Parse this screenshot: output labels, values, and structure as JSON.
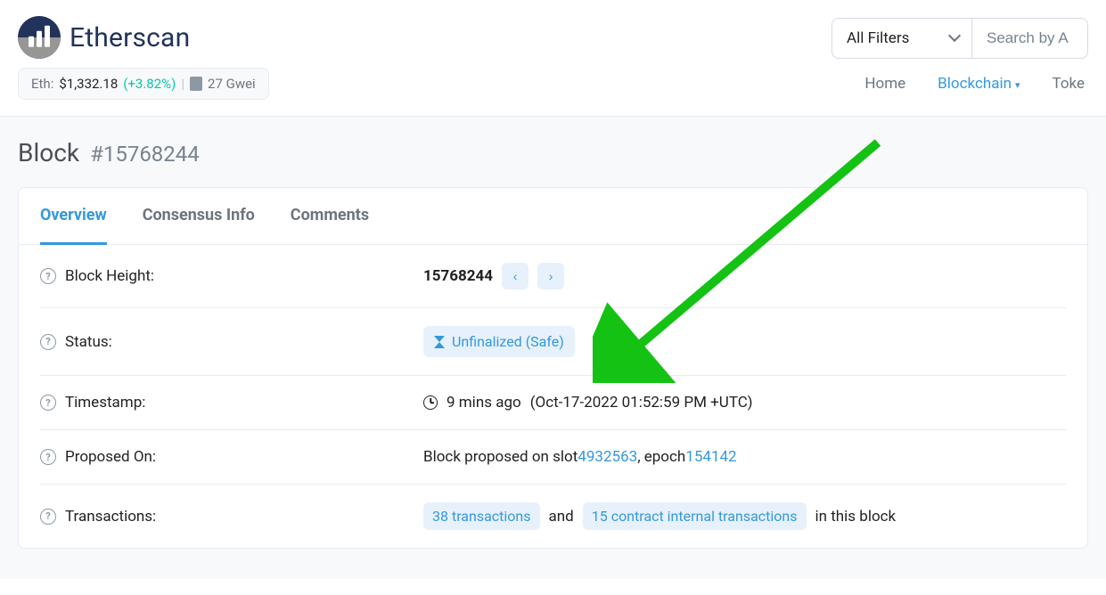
{
  "brand": "Etherscan",
  "filter": {
    "selected": "All Filters"
  },
  "search": {
    "placeholder": "Search by A"
  },
  "price": {
    "prefix": "Eth: ",
    "value": "$1,332.18",
    "pct": "(+3.82%)",
    "sep": "|",
    "gas": "27 Gwei"
  },
  "nav": {
    "home": "Home",
    "blockchain": "Blockchain",
    "tokens": "Toke"
  },
  "title": {
    "label": "Block",
    "number": "#15768244"
  },
  "tabs": {
    "overview": "Overview",
    "consensus": "Consensus Info",
    "comments": "Comments"
  },
  "rows": {
    "height": {
      "label": "Block Height:",
      "value": "15768244"
    },
    "status": {
      "label": "Status:",
      "badge": "Unfinalized (Safe)"
    },
    "timestamp": {
      "label": "Timestamp:",
      "ago": "9 mins ago",
      "full": "(Oct-17-2022 01:52:59 PM +UTC)"
    },
    "proposed": {
      "label": "Proposed On:",
      "prefix": "Block proposed on slot ",
      "slot": "4932563",
      "mid": ", epoch ",
      "epoch": "154142"
    },
    "txs": {
      "label": "Transactions:",
      "tx_chip": "38 transactions",
      "and": "and",
      "internal_chip": "15 contract internal transactions",
      "suffix": "in this block"
    }
  }
}
